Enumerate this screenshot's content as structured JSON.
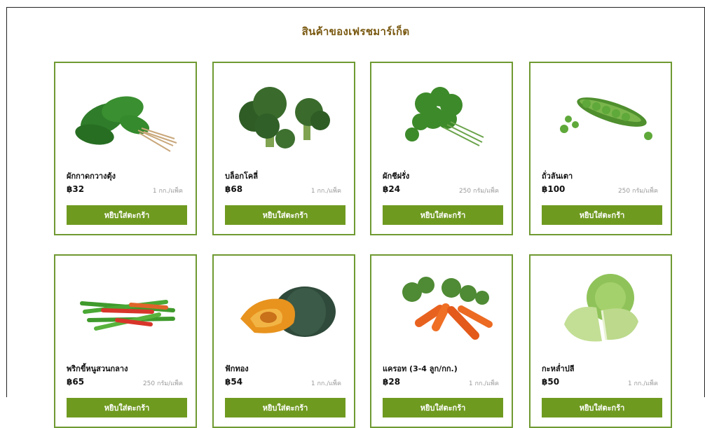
{
  "title": "สินค้าของเฟรชมาร์เก็ต",
  "add_to_cart_label": "หยิบใส่ตะกร้า",
  "products": [
    {
      "name": "ผักกาดกวางตุ้ง",
      "price": "฿32",
      "unit": "1 กก./แพ็ค",
      "icon": "bok-choy-image"
    },
    {
      "name": "บล็อกโคลี่",
      "price": "฿68",
      "unit": "1 กก./แพ็ค",
      "icon": "broccoli-image"
    },
    {
      "name": "ผักชีฝรั่ง",
      "price": "฿24",
      "unit": "250 กรัม/แพ็ค",
      "icon": "parsley-image"
    },
    {
      "name": "ถั่วลันเตา",
      "price": "฿100",
      "unit": "250 กรัม/แพ็ค",
      "icon": "green-peas-image"
    },
    {
      "name": "พริกขี้หนูสวนกลาง",
      "price": "฿65",
      "unit": "250 กรัม/แพ็ค",
      "icon": "chili-image"
    },
    {
      "name": "ฟักทอง",
      "price": "฿54",
      "unit": "1 กก./แพ็ค",
      "icon": "pumpkin-image"
    },
    {
      "name": "แครอท (3-4 ลูก/กก.)",
      "price": "฿28",
      "unit": "1 กก./แพ็ค",
      "icon": "carrot-image"
    },
    {
      "name": "กะหล่ำปลี",
      "price": "฿50",
      "unit": "1 กก./แพ็ค",
      "icon": "cabbage-image"
    }
  ],
  "colors": {
    "accent": "#6f9a20",
    "border": "#6f9a32",
    "title": "#7a5a12"
  }
}
